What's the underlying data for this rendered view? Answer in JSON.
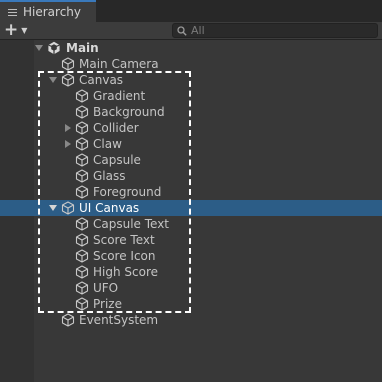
{
  "window": {
    "tab_label": "Hierarchy",
    "tab_icon": "list-icon"
  },
  "toolbar": {
    "add_label": "+",
    "add_icon": "plus-icon",
    "search_placeholder": "All",
    "search_icon": "search-icon"
  },
  "colors": {
    "background": "#383838",
    "selection": "#2c5d87",
    "tab_accent": "#3a79bb",
    "highlight_outline": "#ffffff"
  },
  "tree": [
    {
      "label": "Main",
      "depth": 0,
      "type": "scene",
      "expander": "expanded",
      "icon": "unity-scene-icon"
    },
    {
      "label": "Main Camera",
      "depth": 1,
      "type": "object",
      "expander": "none",
      "icon": "gameobject-icon"
    },
    {
      "label": "Canvas",
      "depth": 1,
      "type": "object",
      "expander": "expanded",
      "icon": "gameobject-icon"
    },
    {
      "label": "Gradient",
      "depth": 2,
      "type": "object",
      "expander": "none",
      "icon": "gameobject-icon"
    },
    {
      "label": "Background",
      "depth": 2,
      "type": "object",
      "expander": "none",
      "icon": "gameobject-icon"
    },
    {
      "label": "Collider",
      "depth": 2,
      "type": "object",
      "expander": "collapsed",
      "icon": "gameobject-icon"
    },
    {
      "label": "Claw",
      "depth": 2,
      "type": "object",
      "expander": "collapsed",
      "icon": "gameobject-icon"
    },
    {
      "label": "Capsule",
      "depth": 2,
      "type": "object",
      "expander": "none",
      "icon": "gameobject-icon"
    },
    {
      "label": "Glass",
      "depth": 2,
      "type": "object",
      "expander": "none",
      "icon": "gameobject-icon"
    },
    {
      "label": "Foreground",
      "depth": 2,
      "type": "object",
      "expander": "none",
      "icon": "gameobject-icon"
    },
    {
      "label": "UI Canvas",
      "depth": 1,
      "type": "object",
      "expander": "expanded",
      "icon": "gameobject-icon",
      "selected": true
    },
    {
      "label": "Capsule Text",
      "depth": 2,
      "type": "object",
      "expander": "none",
      "icon": "gameobject-icon"
    },
    {
      "label": "Score Text",
      "depth": 2,
      "type": "object",
      "expander": "none",
      "icon": "gameobject-icon"
    },
    {
      "label": "Score Icon",
      "depth": 2,
      "type": "object",
      "expander": "none",
      "icon": "gameobject-icon"
    },
    {
      "label": "High Score",
      "depth": 2,
      "type": "object",
      "expander": "none",
      "icon": "gameobject-icon"
    },
    {
      "label": "UFO",
      "depth": 2,
      "type": "object",
      "expander": "none",
      "icon": "gameobject-icon"
    },
    {
      "label": "Prize",
      "depth": 2,
      "type": "object",
      "expander": "none",
      "icon": "gameobject-icon"
    },
    {
      "label": "EventSystem",
      "depth": 1,
      "type": "object",
      "expander": "none",
      "icon": "gameobject-icon"
    }
  ]
}
